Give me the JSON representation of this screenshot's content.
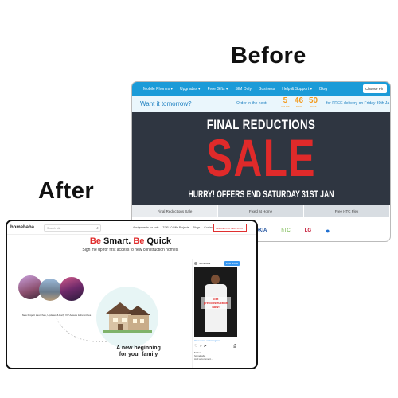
{
  "labels": {
    "before": "Before",
    "after": "After"
  },
  "before": {
    "nav": [
      "Mobile Phones ▾",
      "Upgrades ▾",
      "Free Gifts ▾",
      "SIM Only",
      "Business",
      "Help & Support ▾",
      "Blog"
    ],
    "choose": "Choose Ph",
    "promo": {
      "want": "Want it tomorrow?",
      "order": "Order in the next:",
      "countdown": [
        {
          "n": "5",
          "u": "HOURS"
        },
        {
          "n": "46",
          "u": "MINS"
        },
        {
          "n": "50",
          "u": "SECS"
        }
      ],
      "free": "for FREE delivery on Friday 30th Ja"
    },
    "banner": {
      "final": "FINAL REDUCTIONS",
      "sale": "SALE",
      "hurry": "HURRY! OFFERS END SATURDAY 31ST JAN"
    },
    "tabs": [
      "Final Reductions Sale",
      "Fixed at Home",
      "Free HTC Flex"
    ],
    "brands": [
      "NOKIA",
      "hTC",
      "LG",
      "●"
    ],
    "colors": {
      "nav": "#1b9bd8",
      "banner": "#2f3641",
      "sale": "#e02a2a",
      "countdown": "#f39a1b"
    }
  },
  "after": {
    "logo": "homebaba",
    "search_placeholder": "Search site",
    "links": [
      "Assignments for sale",
      "TOP 10 Bills Projects",
      "Blogs",
      "Contact"
    ],
    "cta": "MARKETING SERVICES",
    "headline": {
      "be1": "Be",
      "smart": "Smart.",
      "be2": "Be",
      "quick": "Quick"
    },
    "sub": "Sign me up for first access to new construction homes.",
    "caption": "New Project Launches, Updates & Early VIP Access & Incentives",
    "new_beginning_1": "A new beginning",
    "new_beginning_2": "for your family",
    "insta": {
      "user": "homebaba",
      "view": "View profile",
      "overlay": "Get preconstruction now!",
      "more": "View more on Instagram",
      "meta": "5 likes\nhomebaba\nAdd a comment..."
    },
    "colors": {
      "accent": "#e02a2a",
      "instagram": "#3897f0"
    }
  }
}
